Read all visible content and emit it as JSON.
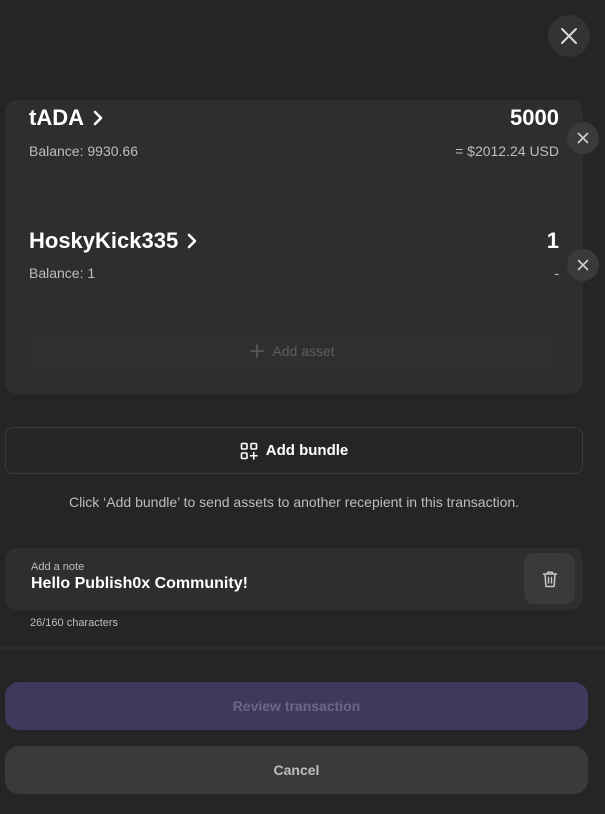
{
  "header": {
    "close_icon": "close-icon"
  },
  "assets": [
    {
      "name": "tADA",
      "amount": "5000",
      "balance": "Balance: 9930.66",
      "fiat": "= $2012.24 USD"
    },
    {
      "name": "HoskyKick335",
      "amount": "1",
      "balance": "Balance: 1",
      "fiat": "-"
    }
  ],
  "add_asset_label": "Add asset",
  "add_bundle_label": "Add bundle",
  "bundle_hint": "Click ‘Add bundle’ to send assets to another recepient in this transaction.",
  "note": {
    "label": "Add a note",
    "value": "Hello Publish0x Community!",
    "char_count": "26/160 characters"
  },
  "actions": {
    "review_label": "Review transaction",
    "cancel_label": "Cancel"
  },
  "colors": {
    "background": "#252526",
    "card": "#2e2e2f",
    "review_button": "#3e3a5e",
    "muted_text": "#bdbdbd"
  }
}
